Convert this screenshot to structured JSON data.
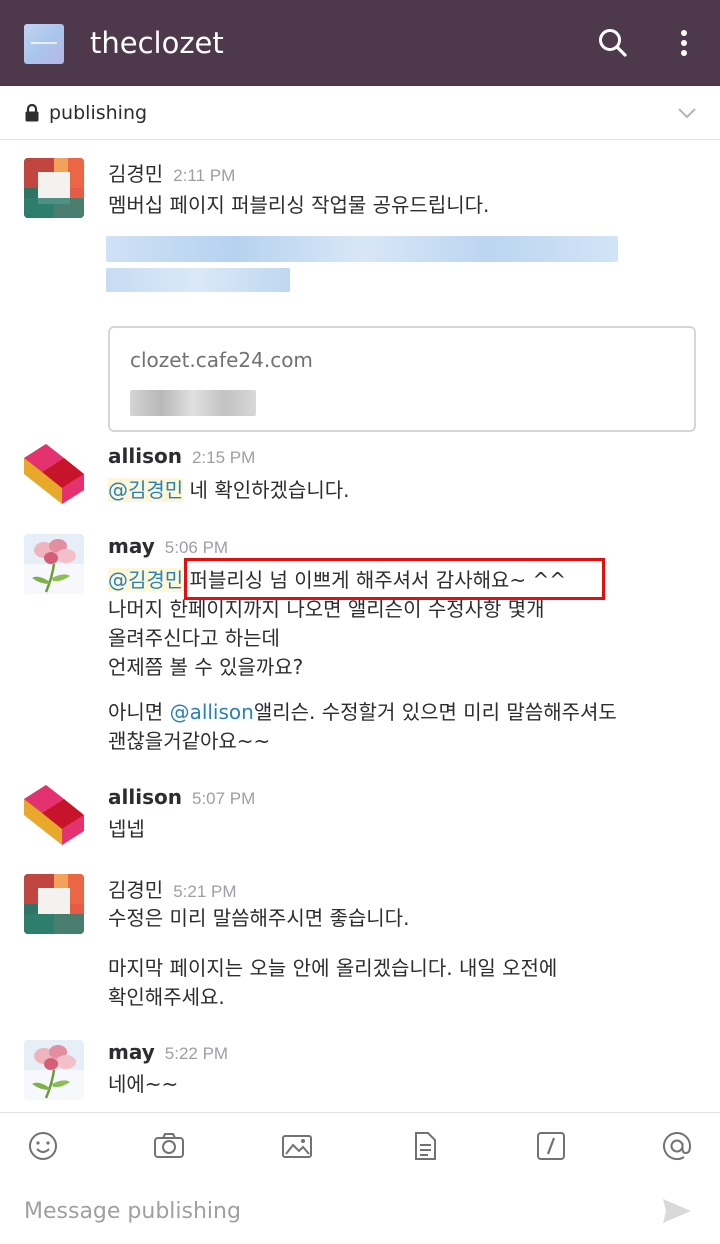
{
  "header": {
    "team_name": "theclozet"
  },
  "channel": {
    "name": "publishing"
  },
  "messages": [
    {
      "author": "김경민",
      "time": "2:11 PM",
      "text": "멤버십 페이지 퍼블리싱 작업물 공유드립니다.",
      "attachment": {
        "title": "clozet.cafe24.com"
      }
    },
    {
      "author": "allison",
      "time": "2:15 PM",
      "mention": "@김경민",
      "text": " 네 확인하겠습니다."
    },
    {
      "author": "may",
      "time": "5:06 PM",
      "mention": "@김경민",
      "line1": " 퍼블리싱 넘 이쁘게 해주셔서 감사해요~ ^^",
      "line2": "나머지 한페이지까지 나오면 앨리슨이 수정사항 몇개",
      "line3": "올려주신다고 하는데",
      "line4": "언제쯤 볼 수 있을까요?",
      "para2_prefix": "아니면 ",
      "para2_mention": "@allison",
      "para2_rest": "앨리슨. 수정할거 있으면 미리 말씀해주셔도",
      "para2_line2": "괜찮을거같아요~~"
    },
    {
      "author": "allison",
      "time": "5:07 PM",
      "text": "넵넵"
    },
    {
      "author": "김경민",
      "time": "5:21 PM",
      "text": "수정은 미리 말씀해주시면 좋습니다.",
      "para2_line1": "마지막 페이지는 오늘 안에 올리겠습니다. 내일 오전에",
      "para2_line2": "확인해주세요."
    },
    {
      "author": "may",
      "time": "5:22 PM",
      "text": "네에~~"
    }
  ],
  "composer": {
    "placeholder": "Message publishing"
  },
  "colors": {
    "header_bg": "#4d394b",
    "mention": "#2a80b9",
    "mention_bg": "#fdf6d7",
    "highlight": "#e01010"
  },
  "icons": [
    "search-icon",
    "more-vertical-icon",
    "lock-icon",
    "chevron-down-icon",
    "emoji-icon",
    "camera-icon",
    "image-icon",
    "file-icon",
    "slash-command-icon",
    "at-mention-icon",
    "send-icon"
  ]
}
